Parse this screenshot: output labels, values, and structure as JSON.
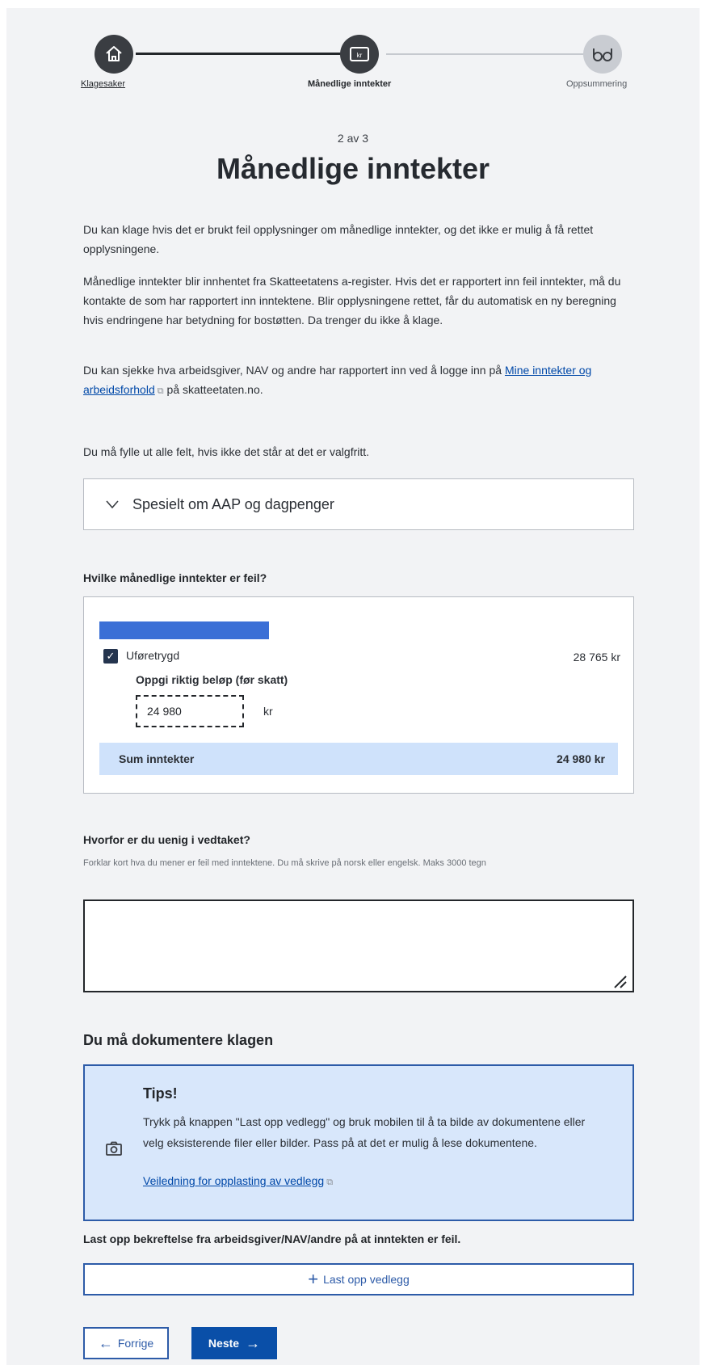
{
  "stepper": {
    "steps": [
      {
        "label": "Klagesaker",
        "icon": "home-icon",
        "state": "done"
      },
      {
        "label": "Månedlige inntekter",
        "icon": "kr-icon",
        "state": "active"
      },
      {
        "label": "Oppsummering",
        "icon": "glasses-icon",
        "state": "todo"
      }
    ]
  },
  "header": {
    "step_count": "2 av 3",
    "title": "Månedlige inntekter"
  },
  "intro": {
    "p1": "Du kan klage hvis det er brukt feil opplysninger om månedlige inntekter, og det ikke er mulig å få rettet opplysningene.",
    "p2": "Månedlige inntekter blir innhentet fra Skatteetatens a-register. Hvis det er rapportert inn feil inntekter, må du kontakte de som har rapportert inn inntektene. Blir opplysningene rettet, får du automatisk en ny beregning hvis endringene har betydning for bostøtten. Da trenger du ikke å klage.",
    "p3_before": "Du kan sjekke hva arbeidsgiver, NAV og andre har rapportert inn ved å logge inn på",
    "p3_link": "Mine inntekter og arbeidsforhold",
    "p3_after": " på skatteetaten.no.",
    "required_note": "Du må fylle ut alle felt, hvis ikke det står at det er valgfritt."
  },
  "accordion": {
    "label": "Spesielt om AAP og dagpenger"
  },
  "income": {
    "question": "Hvilke månedlige inntekter er feil?",
    "item_label": "Uføretrygd",
    "item_checked": true,
    "item_amount": "28 765 kr",
    "correct_amount_label": "Oppgi riktig beløp (før skatt)",
    "correct_amount_value": "24 980",
    "unit": "kr",
    "sum_label": "Sum inntekter",
    "sum_value": "24 980 kr"
  },
  "why": {
    "label": "Hvorfor er du uenig i vedtaket?",
    "hint": "Forklar kort hva du mener er feil med inntektene. Du må skrive på norsk eller engelsk. Maks 3000 tegn",
    "value": ""
  },
  "documentation": {
    "heading": "Du må dokumentere klagen",
    "tips_title": "Tips!",
    "tips_text": "Trykk på knappen \"Last opp vedlegg\" og bruk mobilen til å ta bilde av dokumentene eller velg eksisterende filer eller bilder. Pass på at det er mulig å lese dokumentene.",
    "tips_link": "Veiledning for opplasting av vedlegg",
    "upload_note": "Last opp bekreftelse fra arbeidsgiver/NAV/andre på at inntekten er feil.",
    "upload_button": "Last opp vedlegg"
  },
  "nav": {
    "prev": "Forrige",
    "next": "Neste"
  },
  "colors": {
    "accent": "#0a4fa8",
    "info_bg": "#d8e7fb",
    "sum_bg": "#cfe2fb"
  }
}
